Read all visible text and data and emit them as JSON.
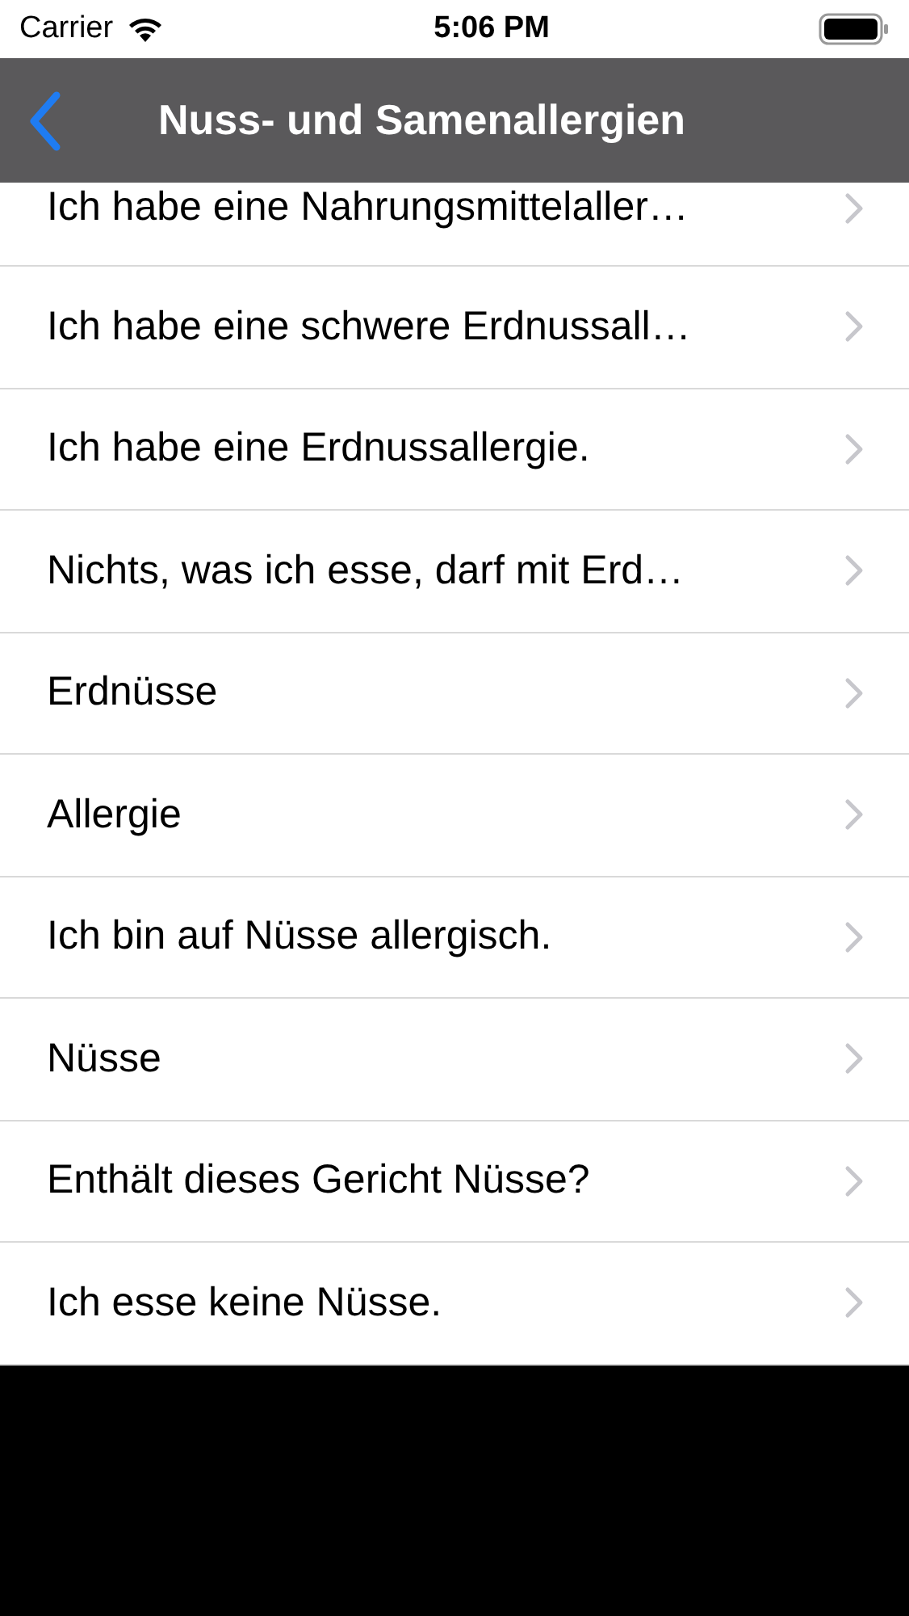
{
  "status_bar": {
    "carrier": "Carrier",
    "time": "5:06 PM"
  },
  "nav_bar": {
    "title": "Nuss- und Samenallergien"
  },
  "rows": [
    {
      "label": "Ich habe eine Nahrungsmittelaller…"
    },
    {
      "label": "Ich habe eine schwere Erdnussall…"
    },
    {
      "label": "Ich habe eine Erdnussallergie."
    },
    {
      "label": "Nichts, was ich esse, darf mit Erd…"
    },
    {
      "label": "Erdnüsse"
    },
    {
      "label": "Allergie"
    },
    {
      "label": "Ich bin auf Nüsse allergisch."
    },
    {
      "label": "Nüsse"
    },
    {
      "label": "Enthält dieses Gericht Nüsse?"
    },
    {
      "label": "Ich esse keine Nüsse."
    }
  ]
}
